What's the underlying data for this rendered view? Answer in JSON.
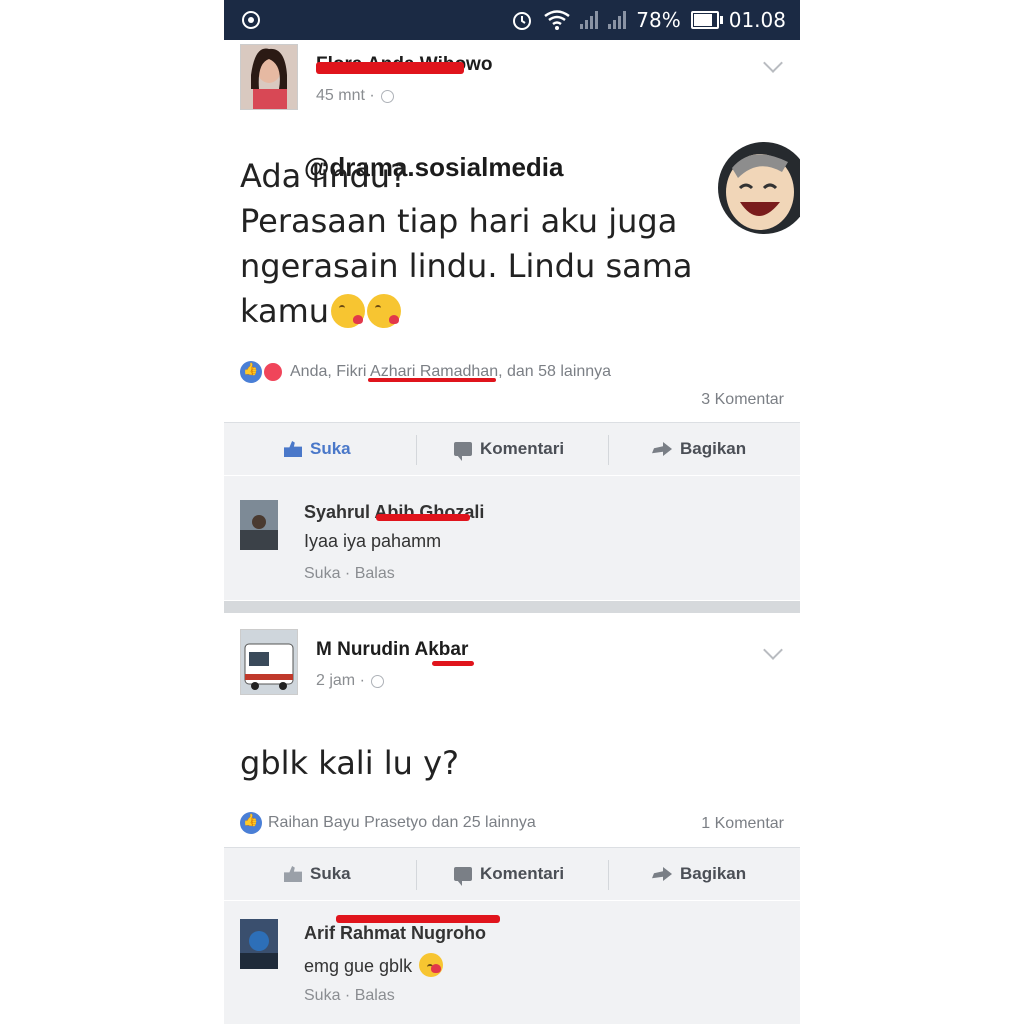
{
  "status_bar": {
    "battery": "78%",
    "time": "01.08",
    "battery_level": 0.78
  },
  "posts": [
    {
      "author": "Flora Anda Wibowo",
      "time": "45 mnt ·",
      "watermark": "@drama.sosialmedia",
      "body_lines": [
        "Ada lindu?",
        "Perasaan tiap hari aku juga",
        "ngerasain lindu. Lindu sama",
        "kamu"
      ],
      "reactions": "Anda, Fikri Azhari Ramadhan, dan 58 lainnya",
      "comment_count": "3 Komentar",
      "comments": [
        {
          "name": "Syahrul Abib Ghozali",
          "text": "Iyaa iya pahamm",
          "actions": "Suka · Balas"
        }
      ]
    },
    {
      "author": "M Nurudin Akbar",
      "time": "2 jam ·",
      "body_lines": [
        "gblk kali lu y?"
      ],
      "reactions": "Raihan Bayu Prasetyo dan 25 lainnya",
      "comment_count": "1 Komentar",
      "comments": [
        {
          "name": "Arif Rahmat Nugroho",
          "text": "emg gue gblk",
          "actions": "Suka · Balas"
        }
      ]
    }
  ],
  "actions": {
    "like": "Suka",
    "comment": "Komentari",
    "share": "Bagikan"
  },
  "colors": {
    "status_bar": "#1b2a44",
    "like_blue": "#4a78c9",
    "redaction": "#e0141c"
  }
}
